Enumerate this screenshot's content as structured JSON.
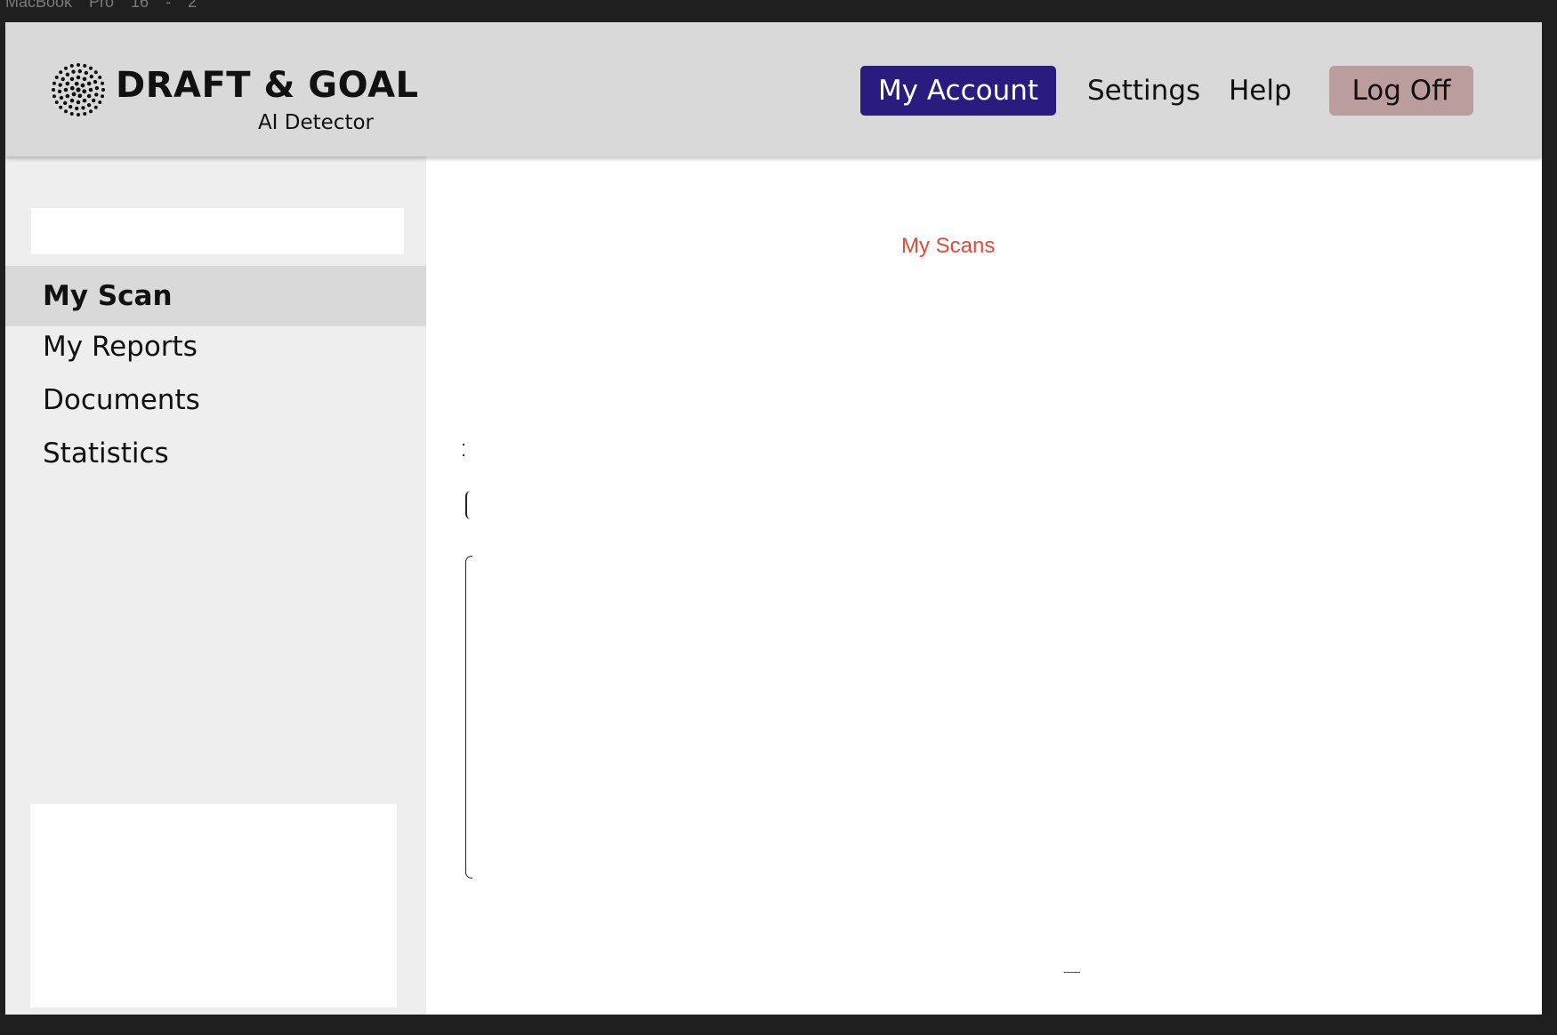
{
  "frame": {
    "label": "MacBook Pro 16 - 2"
  },
  "header": {
    "logo": {
      "title": "DRAFT & GOAL",
      "subtitle": "AI Detector"
    },
    "nav": {
      "my_account": "My Account",
      "settings": "Settings",
      "help": "Help",
      "log_off": "Log Off"
    }
  },
  "sidebar": {
    "search": {
      "value": "",
      "placeholder": ""
    },
    "items": [
      {
        "label": "My Scan",
        "active": true
      },
      {
        "label": "My Reports",
        "active": false
      },
      {
        "label": "Documents",
        "active": false
      },
      {
        "label": "Statistics",
        "active": false
      }
    ]
  },
  "main": {
    "title": "My Scans"
  },
  "colors": {
    "header_bg": "#d9d9d9",
    "sidebar_bg": "#eeeeee",
    "active_item_bg": "#d9d9d9",
    "account_button": "#2a1c7e",
    "logoff_button": "#bc9d9d",
    "title_accent": "#e04b3b"
  },
  "icons": {
    "logo": "dotted-circle-logo-icon"
  }
}
